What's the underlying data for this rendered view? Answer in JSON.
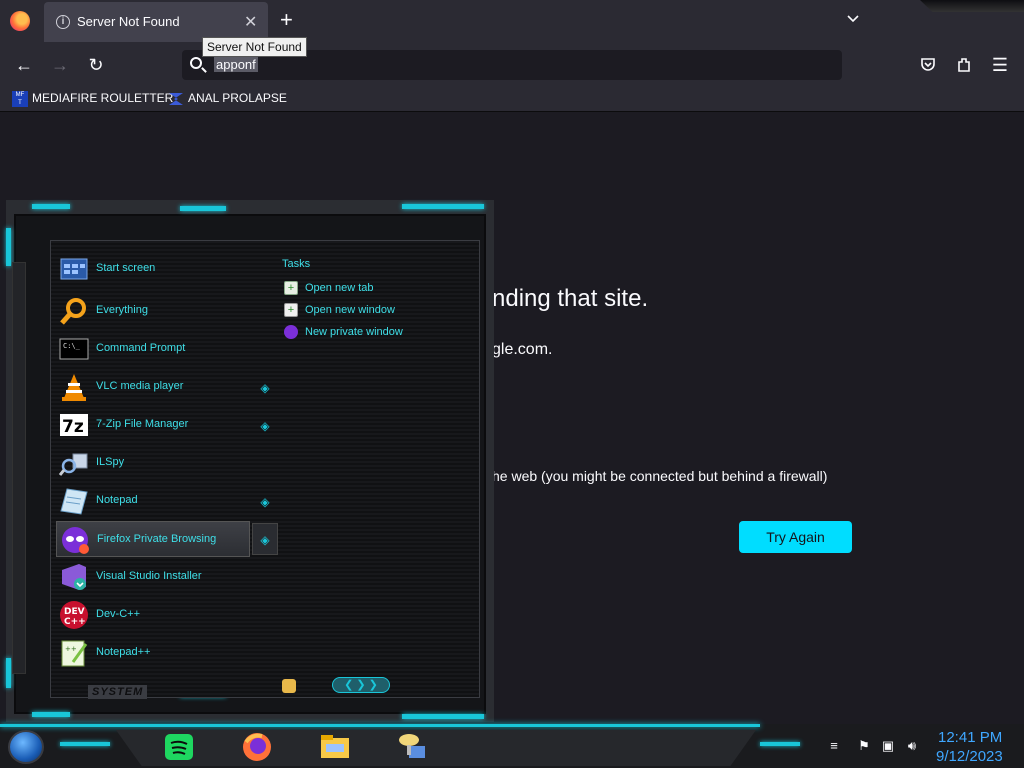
{
  "browser": {
    "tab": {
      "title": "Server Not Found",
      "close_icon": "close-icon"
    },
    "tooltip": "Server Not Found",
    "url": "apponf",
    "bookmarks": [
      {
        "label": "MEDIAFIRE ROULETTER",
        "icon": "mediafire-icon"
      },
      {
        "label": "ANAL PROLAPSE",
        "icon": "bookmark-logo-icon"
      }
    ]
  },
  "error_page": {
    "title_visible": "nding that site.",
    "line_visible": "gle.com.",
    "bullet_visible": "he web (you might be connected but behind a firewall)",
    "try_again_label": "Try Again"
  },
  "start_menu": {
    "items": [
      {
        "label": "Start screen",
        "icon": "start-screen-icon"
      },
      {
        "label": "Everything",
        "icon": "everything-search-icon"
      },
      {
        "label": "Command Prompt",
        "icon": "command-prompt-icon"
      },
      {
        "label": "VLC media player",
        "icon": "vlc-icon"
      },
      {
        "label": "7-Zip File Manager",
        "icon": "7zip-icon"
      },
      {
        "label": "ILSpy",
        "icon": "ilspy-icon"
      },
      {
        "label": "Notepad",
        "icon": "notepad-icon"
      },
      {
        "label": "Firefox Private Browsing",
        "icon": "firefox-private-icon"
      },
      {
        "label": "Visual Studio Installer",
        "icon": "visual-studio-installer-icon"
      },
      {
        "label": "Dev-C++",
        "icon": "devcpp-icon"
      },
      {
        "label": "Notepad++",
        "icon": "notepadpp-icon"
      }
    ],
    "tasks_title": "Tasks",
    "tasks": [
      {
        "label": "Open new tab",
        "icon": "new-tab-icon"
      },
      {
        "label": "Open new window",
        "icon": "new-window-icon"
      },
      {
        "label": "New private window",
        "icon": "private-window-icon"
      }
    ],
    "system_label": "SYSTEM"
  },
  "taskbar": {
    "apps": [
      "spotify-icon",
      "firefox-icon",
      "file-explorer-icon",
      "network-app-icon"
    ],
    "clock": {
      "time": "12:41 PM",
      "date": "9/12/2023"
    }
  },
  "colors": {
    "accent": "#19c6d9",
    "menu_text": "#3fdfe8",
    "button": "#00ddff",
    "clock": "#3fa7ff"
  }
}
